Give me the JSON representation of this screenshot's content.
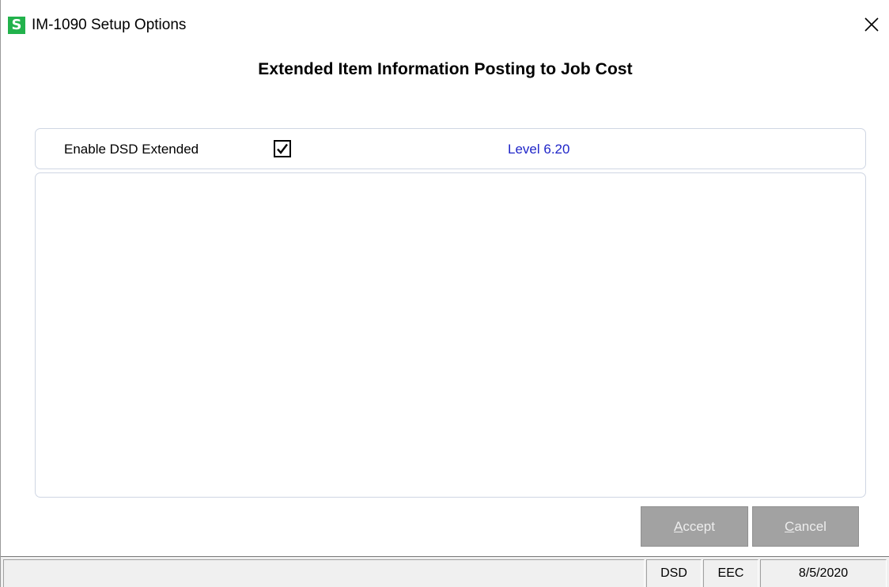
{
  "window": {
    "app_icon_letter": "S",
    "title": "IM-1090 Setup Options",
    "close_glyph": "close-icon"
  },
  "heading": "Extended Item Information Posting to Job Cost",
  "options": {
    "enable_label": "Enable DSD Extended",
    "enable_checked": true,
    "level_text": "Level 6.20",
    "level_color": "#1f25c8"
  },
  "buttons": {
    "accept_mnemonic": "A",
    "accept_rest": "ccept",
    "cancel_mnemonic": "C",
    "cancel_rest": "ancel",
    "disabled_color": "#a2a2a2"
  },
  "statusbar": {
    "main": "",
    "company": "DSD",
    "code": "EEC",
    "date": "8/5/2020"
  },
  "colors": {
    "app_icon_bg": "#22b24c"
  }
}
